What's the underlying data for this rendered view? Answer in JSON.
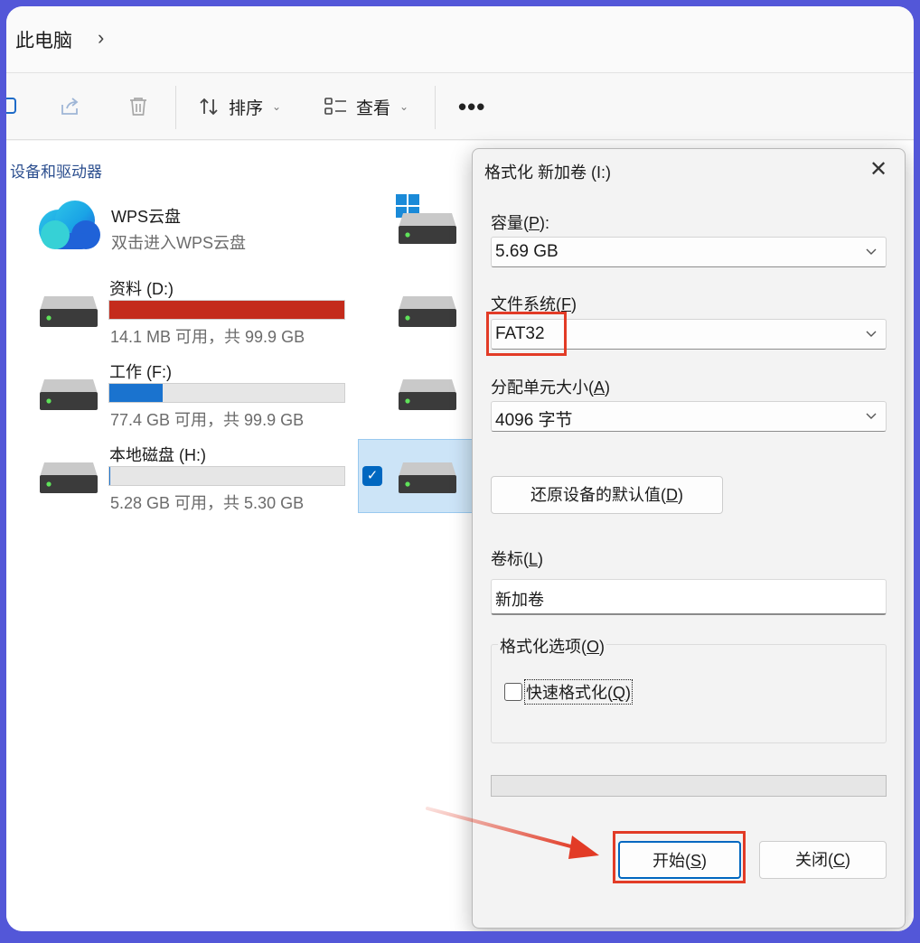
{
  "explorer": {
    "breadcrumb": "此电脑",
    "toolbar": {
      "sort_label": "排序",
      "view_label": "查看",
      "more_label": "•••"
    },
    "section_title": "设备和驱动器",
    "wps": {
      "name": "WPS云盘",
      "subtitle": "双击进入WPS云盘"
    },
    "drives": [
      {
        "name": "资料 (D:)",
        "usage": "14.1 MB 可用，共 99.9 GB",
        "used_fraction": 0.9999,
        "color": "#c42b1c"
      },
      {
        "name": "工作 (F:)",
        "usage": "77.4 GB 可用，共 99.9 GB",
        "used_fraction": 0.225,
        "color": "#1a73cf"
      },
      {
        "name": "本地磁盘 (H:)",
        "usage": "5.28 GB 可用，共 5.30 GB",
        "used_fraction": 0.004,
        "color": "#1a73cf"
      }
    ]
  },
  "dialog": {
    "title": "格式化 新加卷 (I:)",
    "capacity": {
      "label": "容量",
      "key": "P",
      "value": "5.69 GB"
    },
    "filesystem": {
      "label": "文件系统",
      "key": "F",
      "value": "FAT32"
    },
    "allocation": {
      "label": "分配单元大小",
      "key": "A",
      "value": "4096 字节"
    },
    "restore_defaults": {
      "label": "还原设备的默认值",
      "key": "D"
    },
    "volume_label": {
      "label": "卷标",
      "key": "L",
      "value": "新加卷"
    },
    "format_options": {
      "label": "格式化选项",
      "key": "O"
    },
    "quick_format": {
      "label": "快速格式化",
      "key": "Q",
      "checked": false
    },
    "progress": 0,
    "start": {
      "label": "开始",
      "key": "S"
    },
    "close": {
      "label": "关闭",
      "key": "C"
    }
  },
  "colors": {
    "frame": "#5357d8",
    "annotation": "#e23b26",
    "accent": "#0067c0"
  }
}
